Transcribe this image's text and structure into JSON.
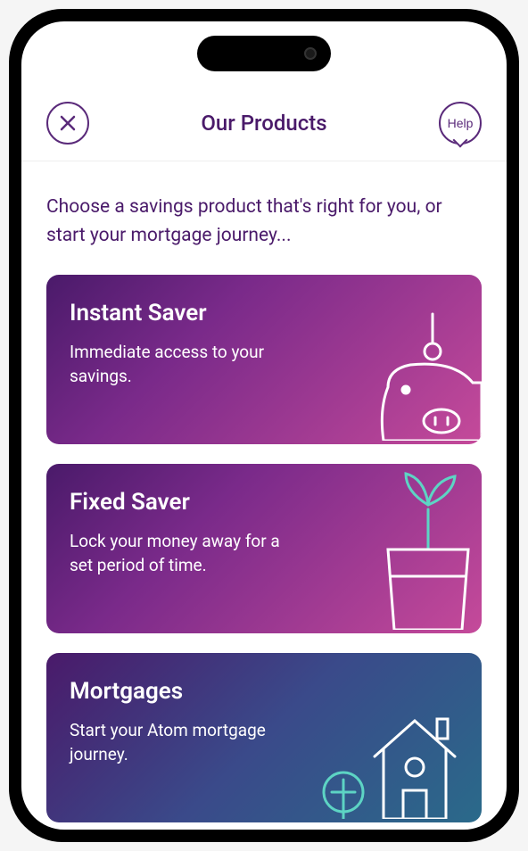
{
  "header": {
    "title": "Our Products",
    "help_label": "Help"
  },
  "intro": "Choose a savings product that's right for you, or start your mortgage journey...",
  "cards": [
    {
      "id": "instant-saver",
      "title": "Instant Saver",
      "description": "Immediate access to your savings.",
      "icon": "piggy-bank-icon"
    },
    {
      "id": "fixed-saver",
      "title": "Fixed Saver",
      "description": "Lock your money away for a set period of time.",
      "icon": "plant-pot-icon"
    },
    {
      "id": "mortgages",
      "title": "Mortgages",
      "description": "Start your Atom mortgage journey.",
      "icon": "house-icon"
    }
  ]
}
